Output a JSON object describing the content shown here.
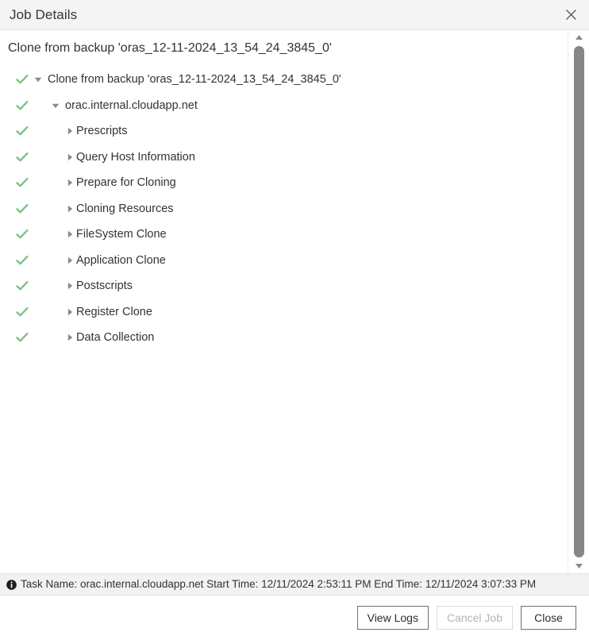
{
  "window": {
    "title": "Job Details",
    "close_icon": "close-icon"
  },
  "heading": "Clone from backup 'oras_12-11-2024_13_54_24_3845_0'",
  "tree": {
    "nodes": [
      {
        "label": "Clone from backup 'oras_12-11-2024_13_54_24_3845_0'",
        "depth": 1,
        "expanded": true,
        "status": "success"
      },
      {
        "label": "orac.internal.cloudapp.net",
        "depth": 2,
        "expanded": true,
        "status": "success"
      },
      {
        "label": "Prescripts",
        "depth": 3,
        "expanded": false,
        "status": "success"
      },
      {
        "label": "Query Host Information",
        "depth": 3,
        "expanded": false,
        "status": "success"
      },
      {
        "label": "Prepare for Cloning",
        "depth": 3,
        "expanded": false,
        "status": "success"
      },
      {
        "label": "Cloning Resources",
        "depth": 3,
        "expanded": false,
        "status": "success"
      },
      {
        "label": "FileSystem Clone",
        "depth": 3,
        "expanded": false,
        "status": "success"
      },
      {
        "label": "Application Clone",
        "depth": 3,
        "expanded": false,
        "status": "success"
      },
      {
        "label": "Postscripts",
        "depth": 3,
        "expanded": false,
        "status": "success"
      },
      {
        "label": "Register Clone",
        "depth": 3,
        "expanded": false,
        "status": "success"
      },
      {
        "label": "Data Collection",
        "depth": 3,
        "expanded": false,
        "status": "success"
      }
    ]
  },
  "statusbar": {
    "icon": "info-icon",
    "text": "Task Name: orac.internal.cloudapp.net Start Time: 12/11/2024 2:53:11 PM End Time: 12/11/2024 3:07:33 PM",
    "task_name": "orac.internal.cloudapp.net",
    "start_time": "12/11/2024 2:53:11 PM",
    "end_time": "12/11/2024 3:07:33 PM"
  },
  "footer": {
    "view_logs_label": "View Logs",
    "cancel_job_label": "Cancel Job",
    "close_label": "Close"
  },
  "scrollbar": {
    "up_icon": "caret-up-icon",
    "down_icon": "caret-down-icon"
  },
  "colors": {
    "success_check": "#7ac47f",
    "twisty": "#8a8a8a",
    "text": "#333333",
    "titlebar_bg": "#f4f4f4",
    "statusbar_bg": "#f2f2f2",
    "scroll_thumb": "#868686"
  }
}
